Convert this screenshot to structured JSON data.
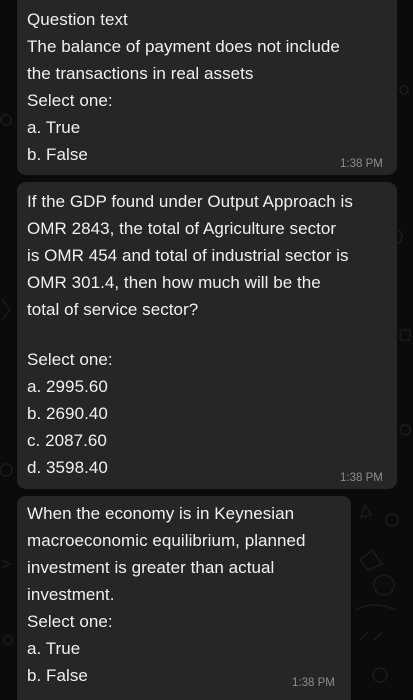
{
  "chat": {
    "messages": [
      {
        "lines": [
          "Question text",
          "The balance of payment does not include",
          "the transactions in real assets",
          "Select one:",
          "a. True",
          "b. False"
        ],
        "time": "1:38 PM"
      },
      {
        "lines": [
          "If the GDP found under Output Approach is",
          "OMR 2843, the total of Agriculture sector",
          "is OMR 454 and total of industrial sector is",
          "OMR 301.4, then how much will be  the",
          "total of service sector?",
          "",
          "Select one:",
          "a. 2995.60",
          "b. 2690.40",
          "c. 2087.60",
          "d. 3598.40"
        ],
        "time": "1:38 PM"
      },
      {
        "lines": [
          "When the economy is in Keynesian",
          "macroeconomic equilibrium, planned",
          "investment is greater than actual",
          "investment.",
          "Select one:",
          "a. True",
          "b. False"
        ],
        "time": "1:38 PM"
      }
    ]
  },
  "colors": {
    "background": "#0b0b0b",
    "bubble": "#262626",
    "text": "#f0f0f0",
    "timestamp": "#8d8d8d"
  }
}
